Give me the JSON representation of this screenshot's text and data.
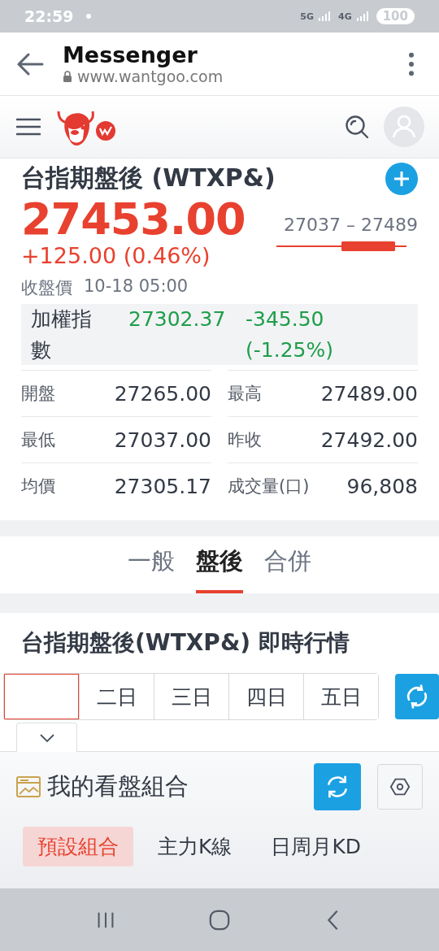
{
  "status_bar": {
    "time": "22:59",
    "network_1": "5G",
    "network_2": "4G",
    "battery": "100"
  },
  "browser": {
    "title": "Messenger",
    "url": "www.wantgoo.com"
  },
  "quote": {
    "title": "台指期盤後 (WTXP&)",
    "price": "27453.00",
    "change": "+125.00 (0.46%)",
    "range": "27037 – 27489",
    "close_label": "收盤價",
    "close_time": "10-18 05:00",
    "index": {
      "label": "加權指數",
      "value": "27302.37",
      "change": "-345.50 (-1.25%)"
    },
    "stats": [
      {
        "label": "開盤",
        "value": "27265.00"
      },
      {
        "label": "最高",
        "value": "27489.00"
      },
      {
        "label": "最低",
        "value": "27037.00"
      },
      {
        "label": "昨收",
        "value": "27492.00"
      },
      {
        "label": "均價",
        "value": "27305.17"
      },
      {
        "label": "成交量(口)",
        "value": "96,808"
      }
    ]
  },
  "tabs": [
    {
      "label": "一般",
      "selected": false
    },
    {
      "label": "盤後",
      "selected": true
    },
    {
      "label": "合併",
      "selected": false
    }
  ],
  "section": {
    "title": "台指期盤後(WTXP&) 即時行情",
    "day_tabs": [
      {
        "selected": true
      },
      {
        "label": "二日",
        "selected": false
      },
      {
        "label": "三日",
        "selected": false
      },
      {
        "label": "四日",
        "selected": false
      },
      {
        "label": "五日",
        "selected": false
      }
    ]
  },
  "panel": {
    "title": "我的看盤組合",
    "combos": [
      {
        "label": "預設組合",
        "selected": true
      },
      {
        "label": "主力K線",
        "selected": false
      },
      {
        "label": "日周月KD",
        "selected": false
      }
    ]
  }
}
